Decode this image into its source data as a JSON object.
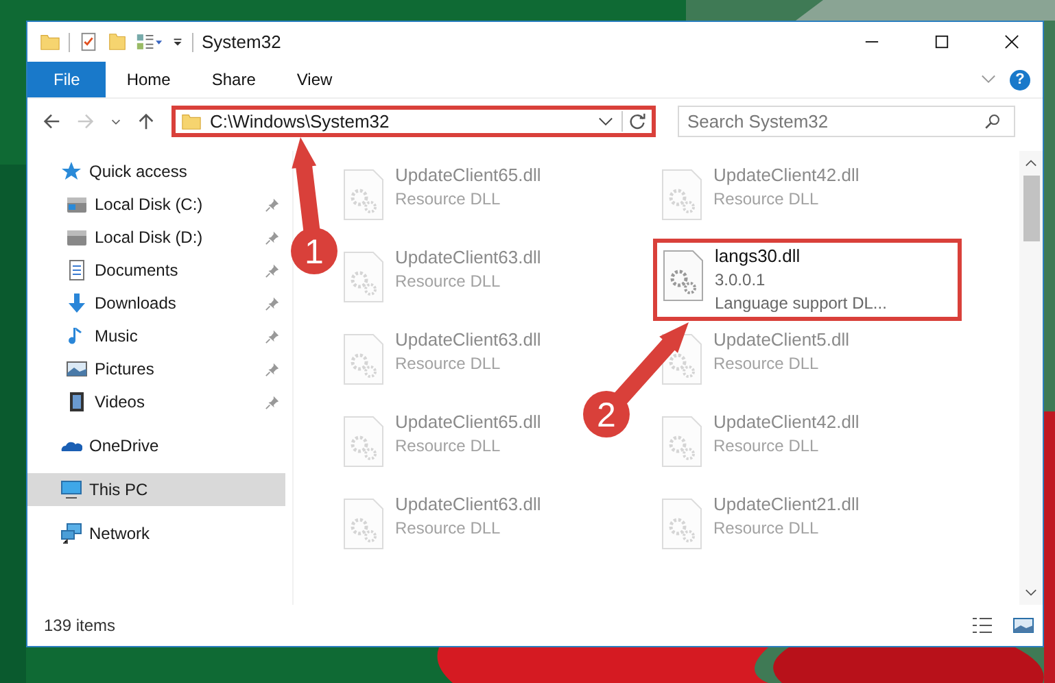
{
  "window": {
    "title": "System32",
    "status_bar": {
      "item_count": "139 items"
    }
  },
  "ribbon": {
    "tabs": [
      {
        "label": "File",
        "selected": true
      },
      {
        "label": "Home",
        "selected": false
      },
      {
        "label": "Share",
        "selected": false
      },
      {
        "label": "View",
        "selected": false
      }
    ],
    "help": "?"
  },
  "address_bar": {
    "path": "C:\\Windows\\System32",
    "highlighted": true
  },
  "search": {
    "placeholder": "Search System32"
  },
  "sidebar": {
    "items": [
      {
        "label": "Quick access",
        "selected": false,
        "children": [
          {
            "label": "Local Disk (C:)",
            "pinned": true
          },
          {
            "label": "Local Disk (D:)",
            "pinned": true
          },
          {
            "label": "Documents",
            "pinned": true
          },
          {
            "label": "Downloads",
            "pinned": true
          },
          {
            "label": "Music",
            "pinned": true
          },
          {
            "label": "Pictures",
            "pinned": true
          },
          {
            "label": "Videos",
            "pinned": true
          }
        ]
      },
      {
        "label": "OneDrive",
        "selected": false
      },
      {
        "label": "This PC",
        "selected": true
      },
      {
        "label": "Network",
        "selected": false
      }
    ]
  },
  "files": [
    {
      "name": "UpdateClient65.dll",
      "lines": [
        "Resource DLL"
      ],
      "highlighted": false
    },
    {
      "name": "UpdateClient42.dll",
      "lines": [
        "Resource DLL"
      ],
      "highlighted": false
    },
    {
      "name": "UpdateClient63.dll",
      "lines": [
        "Resource DLL"
      ],
      "highlighted": false
    },
    {
      "name": "langs30.dll",
      "lines": [
        "3.0.0.1",
        "Language support DL..."
      ],
      "highlighted": true
    },
    {
      "name": "UpdateClient63.dll",
      "lines": [
        "Resource DLL"
      ],
      "highlighted": false
    },
    {
      "name": "UpdateClient5.dll",
      "lines": [
        "Resource DLL"
      ],
      "highlighted": false
    },
    {
      "name": "UpdateClient65.dll",
      "lines": [
        "Resource DLL"
      ],
      "highlighted": false
    },
    {
      "name": "UpdateClient42.dll",
      "lines": [
        "Resource DLL"
      ],
      "highlighted": false
    },
    {
      "name": "UpdateClient63.dll",
      "lines": [
        "Resource DLL"
      ],
      "highlighted": false
    },
    {
      "name": "UpdateClient21.dll",
      "lines": [
        "Resource DLL"
      ],
      "highlighted": false
    }
  ],
  "annotations": [
    {
      "number": "1"
    },
    {
      "number": "2"
    }
  ]
}
